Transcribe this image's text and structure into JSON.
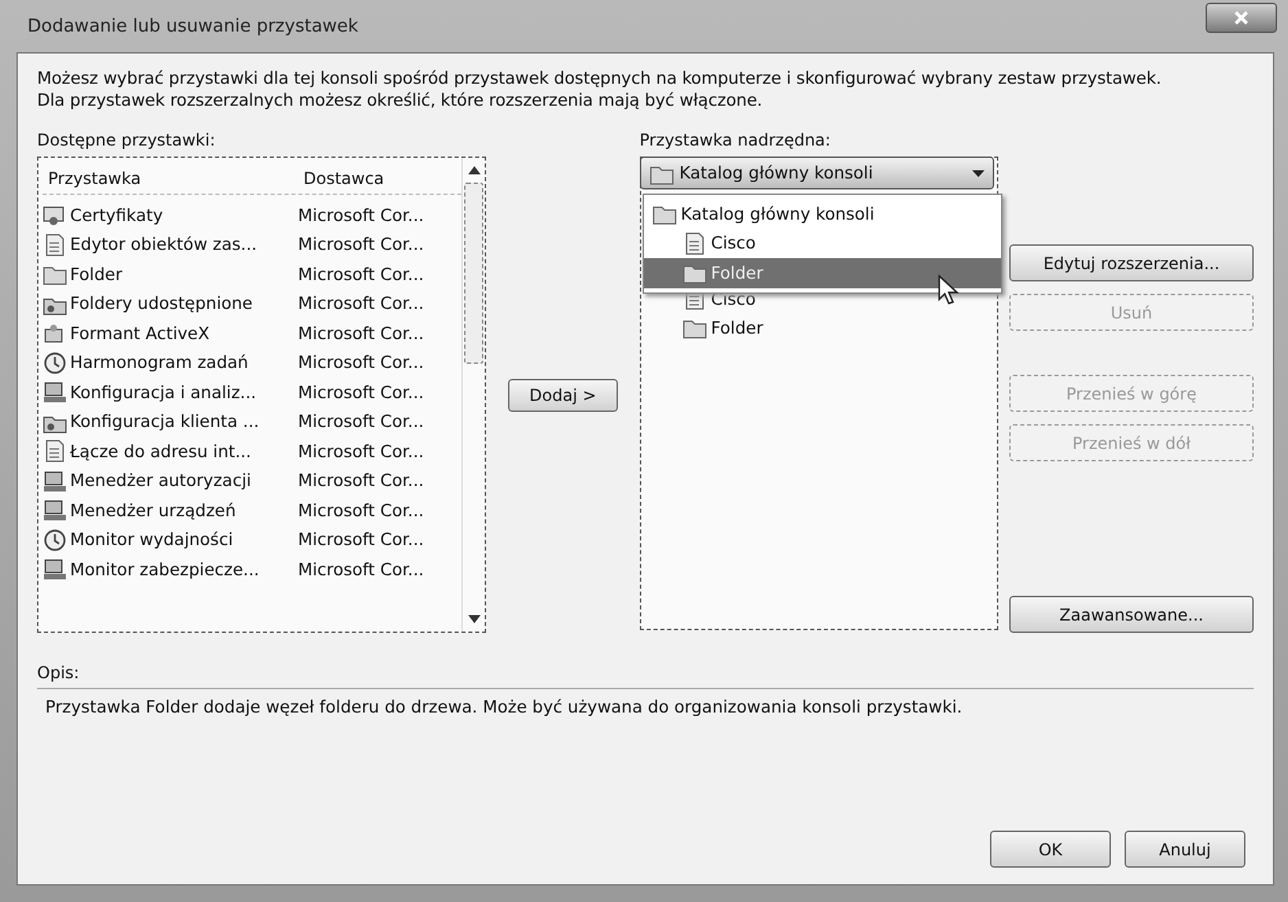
{
  "window": {
    "title": "Dodawanie lub usuwanie przystawek"
  },
  "intro": [
    "Możesz wybrać przystawki dla tej konsoli spośród przystawek dostępnych na komputerze i skonfigurować wybrany zestaw przystawek.",
    "Dla przystawek rozszerzalnych możesz określić, które rozszerzenia mają być włączone."
  ],
  "available": {
    "label": "Dostępne przystawki:",
    "columns": [
      "Przystawka",
      "Dostawca"
    ],
    "rows": [
      {
        "kind": "certificate",
        "name": "Certyfikaty",
        "vendor": "Microsoft Cor..."
      },
      {
        "kind": "document",
        "name": "Edytor obiektów zas...",
        "vendor": "Microsoft Cor..."
      },
      {
        "kind": "folder",
        "name": "Folder",
        "vendor": "Microsoft Cor..."
      },
      {
        "kind": "share",
        "name": "Foldery udostępnione",
        "vendor": "Microsoft Cor..."
      },
      {
        "kind": "control",
        "name": "Formant ActiveX",
        "vendor": "Microsoft Cor..."
      },
      {
        "kind": "clock",
        "name": "Harmonogram zadań",
        "vendor": "Microsoft Cor..."
      },
      {
        "kind": "computer",
        "name": "Konfiguracja i analiz...",
        "vendor": "Microsoft Cor..."
      },
      {
        "kind": "share",
        "name": "Konfiguracja klienta ...",
        "vendor": "Microsoft Cor..."
      },
      {
        "kind": "document",
        "name": "Łącze do adresu int...",
        "vendor": "Microsoft Cor..."
      },
      {
        "kind": "computer",
        "name": "Menedżer autoryzacji",
        "vendor": "Microsoft Cor..."
      },
      {
        "kind": "computer",
        "name": "Menedżer urządzeń",
        "vendor": "Microsoft Cor..."
      },
      {
        "kind": "clock",
        "name": "Monitor wydajności",
        "vendor": "Microsoft Cor..."
      },
      {
        "kind": "computer",
        "name": "Monitor zabezpiecze...",
        "vendor": "Microsoft Cor..."
      }
    ]
  },
  "add_button": "Dodaj >",
  "parent": {
    "label": "Przystawka nadrzędna:",
    "combo_value": "Katalog główny konsoli",
    "dropdown": [
      {
        "kind": "folder",
        "label": "Katalog główny konsoli",
        "selected": false,
        "children": [
          {
            "kind": "document",
            "label": "Cisco",
            "selected": false
          },
          {
            "kind": "folder",
            "label": "Folder",
            "selected": true
          }
        ]
      }
    ],
    "tree": [
      {
        "kind": "document",
        "label": "Cisco"
      },
      {
        "kind": "folder",
        "label": "Folder"
      }
    ]
  },
  "side_buttons": [
    {
      "label": "Edytuj rozszerzenia...",
      "disabled": false
    },
    {
      "label": "Usuń",
      "disabled": true
    },
    {
      "label": "Przenieś w górę",
      "disabled": true
    },
    {
      "label": "Przenieś w dół",
      "disabled": true
    },
    {
      "label": "Zaawansowane...",
      "disabled": false
    }
  ],
  "description": {
    "label": "Opis:",
    "text": "Przystawka Folder dodaje węzeł folderu do drzewa. Może być używana do organizowania konsoli przystawki."
  },
  "buttons": [
    "OK",
    "Anuluj"
  ]
}
